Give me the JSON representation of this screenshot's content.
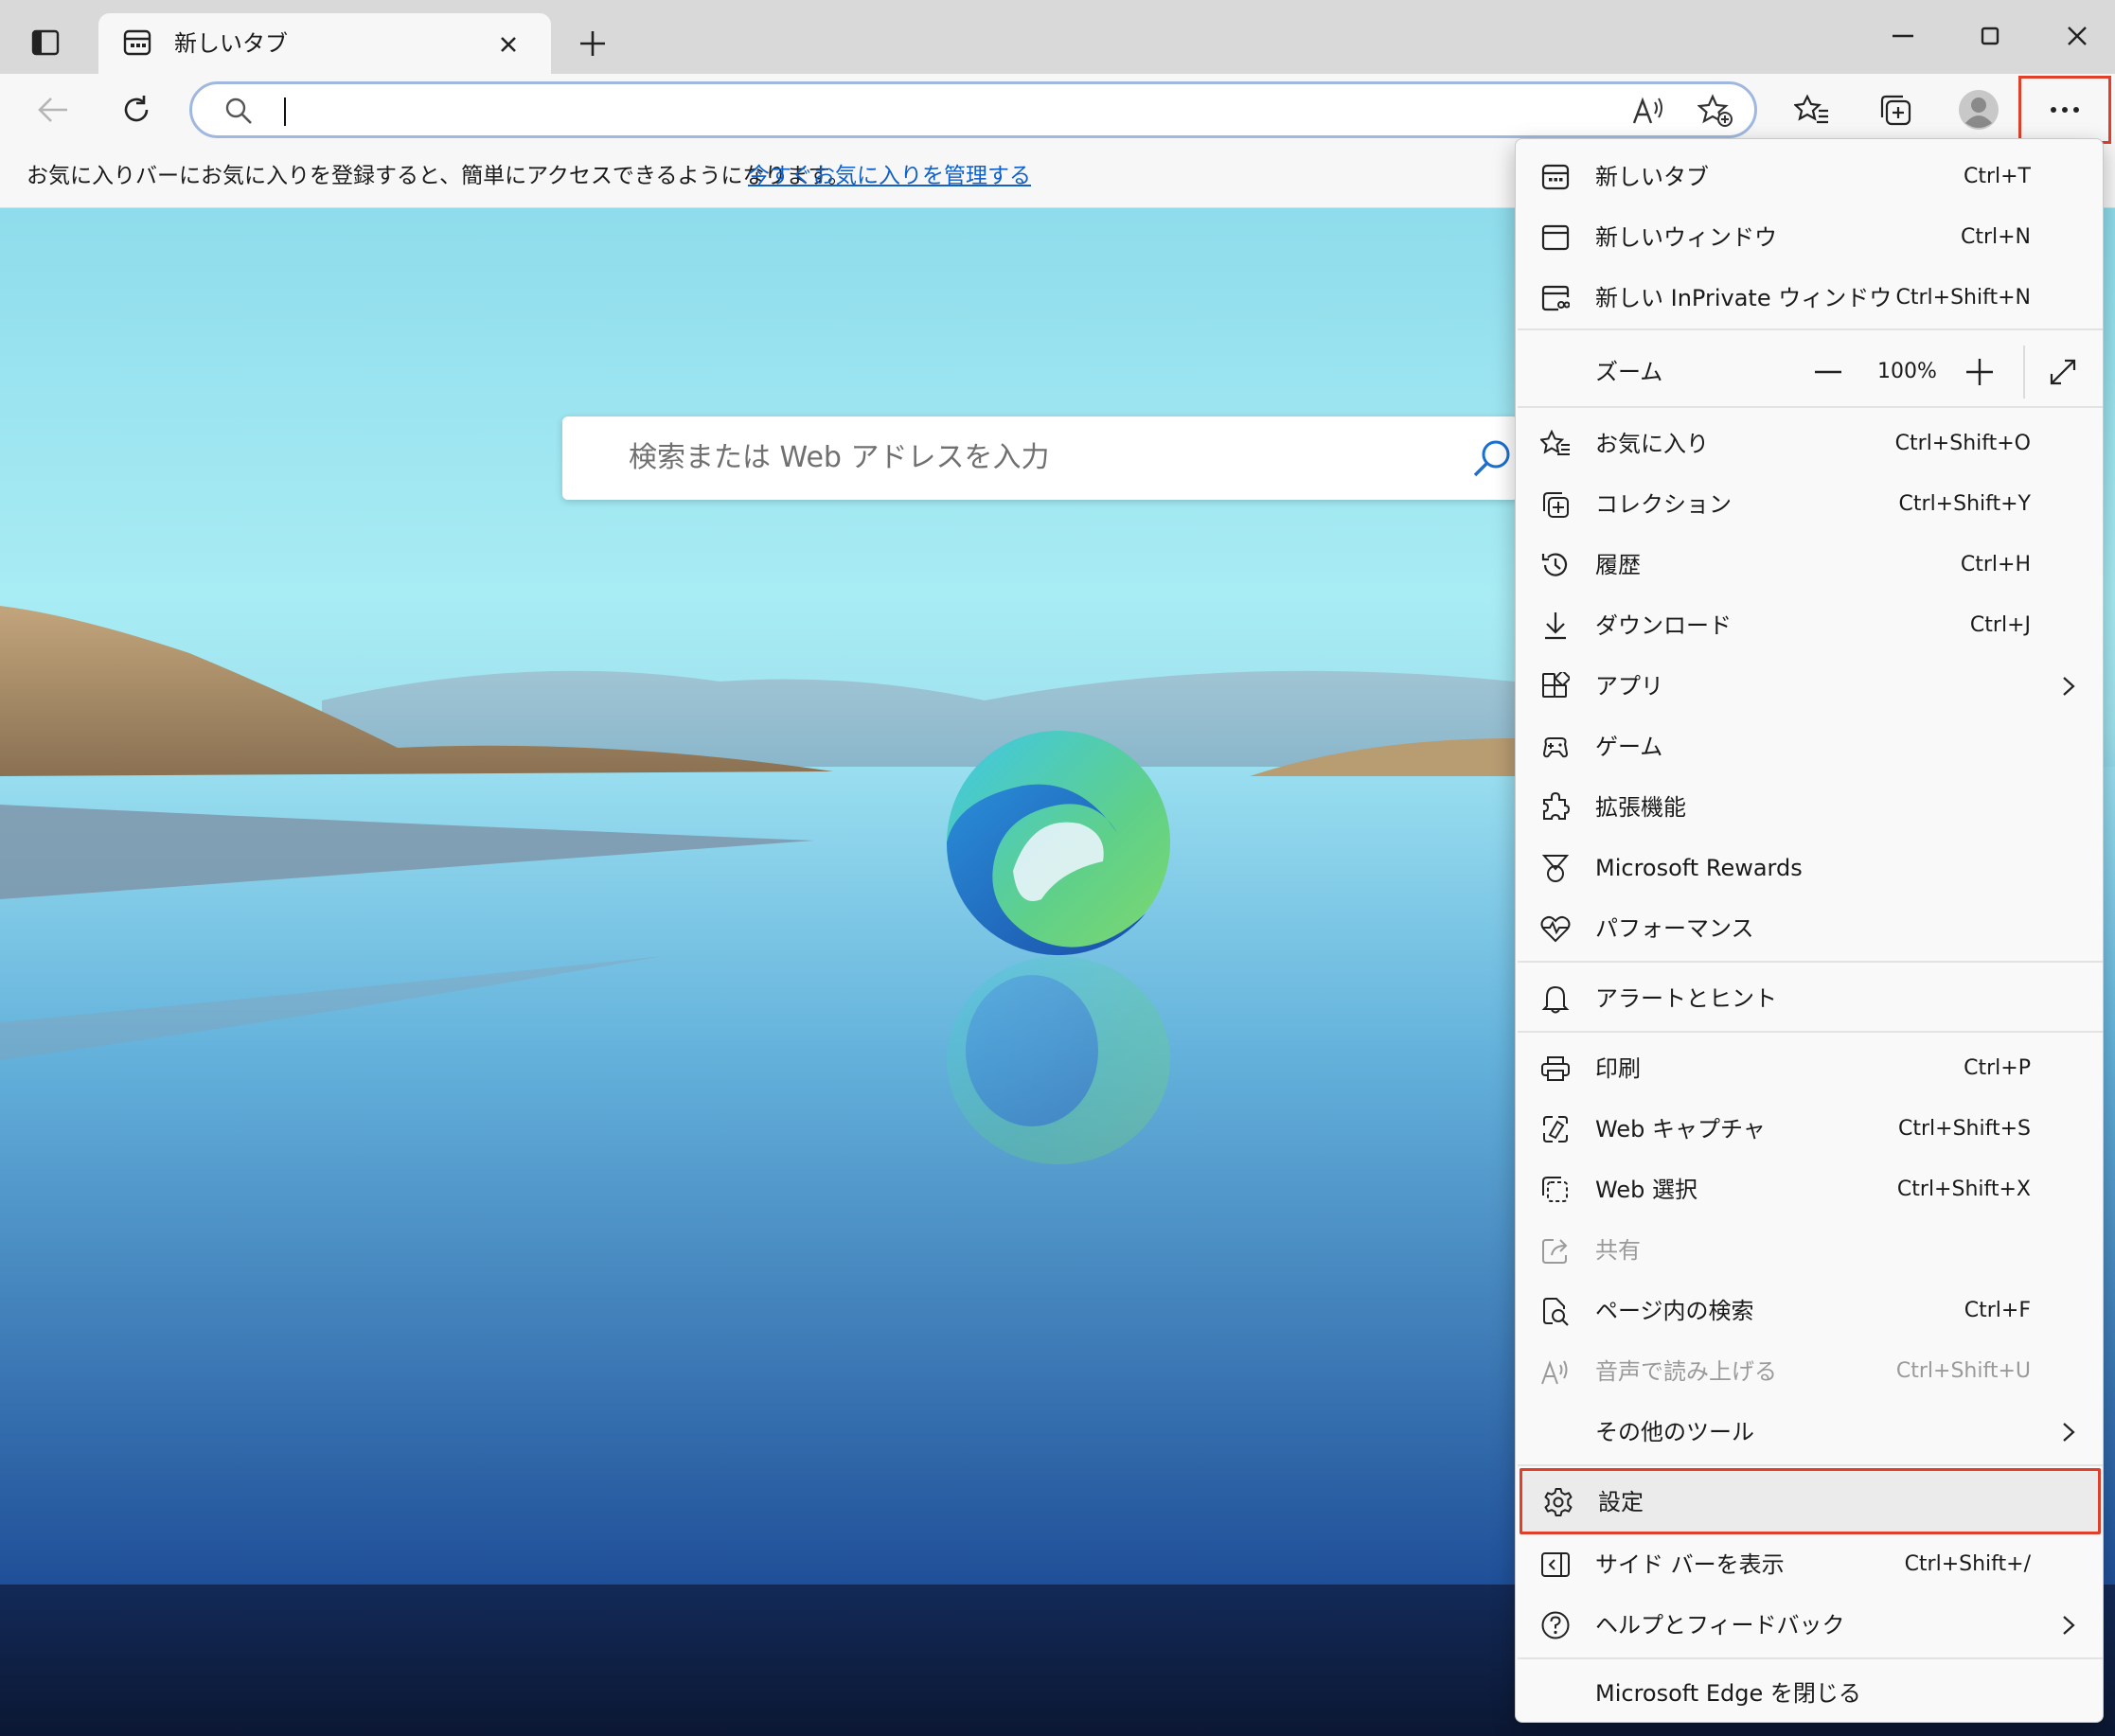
{
  "tab": {
    "title": "新しいタブ"
  },
  "address": {
    "value": ""
  },
  "favorites_bar": {
    "message": "お気に入りバーにお気に入りを登録すると、簡単にアクセスできるようになります。",
    "link": "今すぐお気に入りを管理する"
  },
  "page": {
    "search_placeholder": "検索または Web アドレスを入力"
  },
  "menu": {
    "group1": [
      {
        "label": "新しいタブ",
        "shortcut": "Ctrl+T",
        "icon": "new-tab-icon"
      },
      {
        "label": "新しいウィンドウ",
        "shortcut": "Ctrl+N",
        "icon": "new-window-icon"
      },
      {
        "label": "新しい InPrivate ウィンドウ",
        "shortcut": "Ctrl+Shift+N",
        "icon": "inprivate-icon"
      }
    ],
    "zoom": {
      "label": "ズーム",
      "value": "100%"
    },
    "group2": [
      {
        "label": "お気に入り",
        "shortcut": "Ctrl+Shift+O",
        "icon": "favorites-icon"
      },
      {
        "label": "コレクション",
        "shortcut": "Ctrl+Shift+Y",
        "icon": "collections-icon"
      },
      {
        "label": "履歴",
        "shortcut": "Ctrl+H",
        "icon": "history-icon"
      },
      {
        "label": "ダウンロード",
        "shortcut": "Ctrl+J",
        "icon": "download-icon"
      },
      {
        "label": "アプリ",
        "shortcut": "",
        "icon": "apps-icon"
      },
      {
        "label": "ゲーム",
        "shortcut": "",
        "icon": "games-icon"
      },
      {
        "label": "拡張機能",
        "shortcut": "",
        "icon": "extensions-icon"
      },
      {
        "label": "Microsoft Rewards",
        "shortcut": "",
        "icon": "rewards-icon"
      },
      {
        "label": "パフォーマンス",
        "shortcut": "",
        "icon": "performance-icon"
      }
    ],
    "alerts": {
      "label": "アラートとヒント",
      "icon": "bell-icon"
    },
    "group3": [
      {
        "label": "印刷",
        "shortcut": "Ctrl+P",
        "icon": "print-icon"
      },
      {
        "label": "Web キャプチャ",
        "shortcut": "Ctrl+Shift+S",
        "icon": "web-capture-icon"
      },
      {
        "label": "Web 選択",
        "shortcut": "Ctrl+Shift+X",
        "icon": "web-select-icon"
      },
      {
        "label": "共有",
        "shortcut": "",
        "icon": "share-icon"
      },
      {
        "label": "ページ内の検索",
        "shortcut": "Ctrl+F",
        "icon": "find-icon"
      },
      {
        "label": "音声で読み上げる",
        "shortcut": "Ctrl+Shift+U",
        "icon": "read-aloud-icon"
      },
      {
        "label": "その他のツール",
        "shortcut": "",
        "icon": ""
      }
    ],
    "group4": [
      {
        "label": "設定",
        "shortcut": "",
        "icon": "gear-icon"
      },
      {
        "label": "サイド バーを表示",
        "shortcut": "Ctrl+Shift+/",
        "icon": "sidebar-icon"
      },
      {
        "label": "ヘルプとフィードバック",
        "shortcut": "",
        "icon": "help-icon"
      }
    ],
    "close": {
      "label": "Microsoft Edge を閉じる"
    }
  },
  "colors": {
    "accent": "#e0402a",
    "link": "#1060c8",
    "menu_bg": "#f9f9f9",
    "tabstrip": "#d9d9d9"
  }
}
